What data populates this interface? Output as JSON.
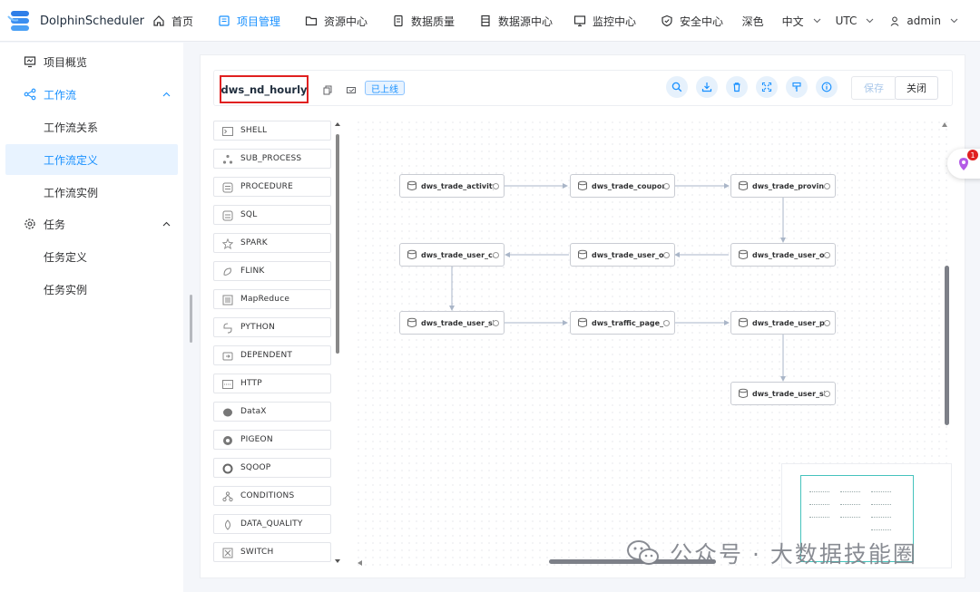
{
  "app": {
    "name": "DolphinScheduler"
  },
  "nav": {
    "items": [
      {
        "label": "首页",
        "icon": "home-icon"
      },
      {
        "label": "项目管理",
        "icon": "project-icon",
        "active": true
      },
      {
        "label": "资源中心",
        "icon": "folder-icon"
      },
      {
        "label": "数据质量",
        "icon": "data-quality-icon"
      },
      {
        "label": "数据源中心",
        "icon": "datasource-icon"
      },
      {
        "label": "监控中心",
        "icon": "monitor-icon"
      },
      {
        "label": "安全中心",
        "icon": "shield-icon"
      }
    ],
    "theme": "深色",
    "language": "中文",
    "timezone": "UTC",
    "user": "admin"
  },
  "sidebar": {
    "overview": "项目概览",
    "workflow": "工作流",
    "workflow_relation": "工作流关系",
    "workflow_definition": "工作流定义",
    "workflow_instance": "工作流实例",
    "task": "任务",
    "task_definition": "任务定义",
    "task_instance": "任务实例"
  },
  "toolbar": {
    "workflow_name": "dws_nd_hourly",
    "status_badge": "已上线",
    "save_label": "保存",
    "close_label": "关闭",
    "tools": [
      "search-icon",
      "download-icon",
      "delete-icon",
      "fullscreen-icon",
      "format-icon",
      "info-icon"
    ],
    "accent_color": "#1890ff"
  },
  "task_types": [
    "SHELL",
    "SUB_PROCESS",
    "PROCEDURE",
    "SQL",
    "SPARK",
    "FLINK",
    "MapReduce",
    "PYTHON",
    "DEPENDENT",
    "HTTP",
    "DataX",
    "PIGEON",
    "SQOOP",
    "CONDITIONS",
    "DATA_QUALITY",
    "SWITCH"
  ],
  "dag": {
    "nodes": [
      "dws_trade_activity...",
      "dws_trade_coupon_...",
      "dws_trade_province",
      "dws_trade_user_car...",
      "dws_trade_user_ord",
      "dws_trade_user_ord",
      "dws_trade_user_sku",
      "dws_traffic_page_v...",
      "dws_trade_user_pay",
      "dws_trade_user_sku"
    ]
  },
  "watermark": "公众号 · 大数据技能圈",
  "notification_count": "1"
}
